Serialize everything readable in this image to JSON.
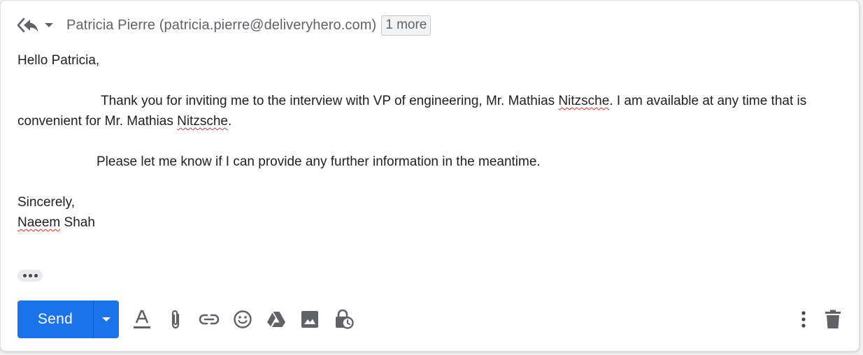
{
  "header": {
    "reply_icon": "reply-all-icon",
    "dropdown_icon": "chevron-down-icon",
    "recipient": "Patricia Pierre (patricia.pierre@deliveryhero.com)",
    "more_chip": "1 more"
  },
  "body": {
    "greeting": "Hello Patricia,",
    "para1_a": "Thank you for inviting me to the interview with VP of engineering, Mr. Mathias ",
    "para1_word1": "Nitzsche",
    "para1_b": ". I am available at any time that is convenient for Mr. Mathias ",
    "para1_word2": "Nitzsche",
    "para1_c": ".",
    "para2": "Please let me know if I can provide any further information in the meantime.",
    "closing": "Sincerely,",
    "signature_first": "Naeem",
    "signature_last": " Shah"
  },
  "toolbar": {
    "send_label": "Send",
    "icons": [
      "formatting-icon",
      "attach-icon",
      "link-icon",
      "emoji-icon",
      "drive-icon",
      "photo-icon",
      "confidential-mode-icon",
      "more-options-icon",
      "delete-icon"
    ]
  },
  "colors": {
    "accent": "#1a73e8",
    "text": "#202124",
    "muted": "#5f6368",
    "spellcheck": "#d93025"
  }
}
